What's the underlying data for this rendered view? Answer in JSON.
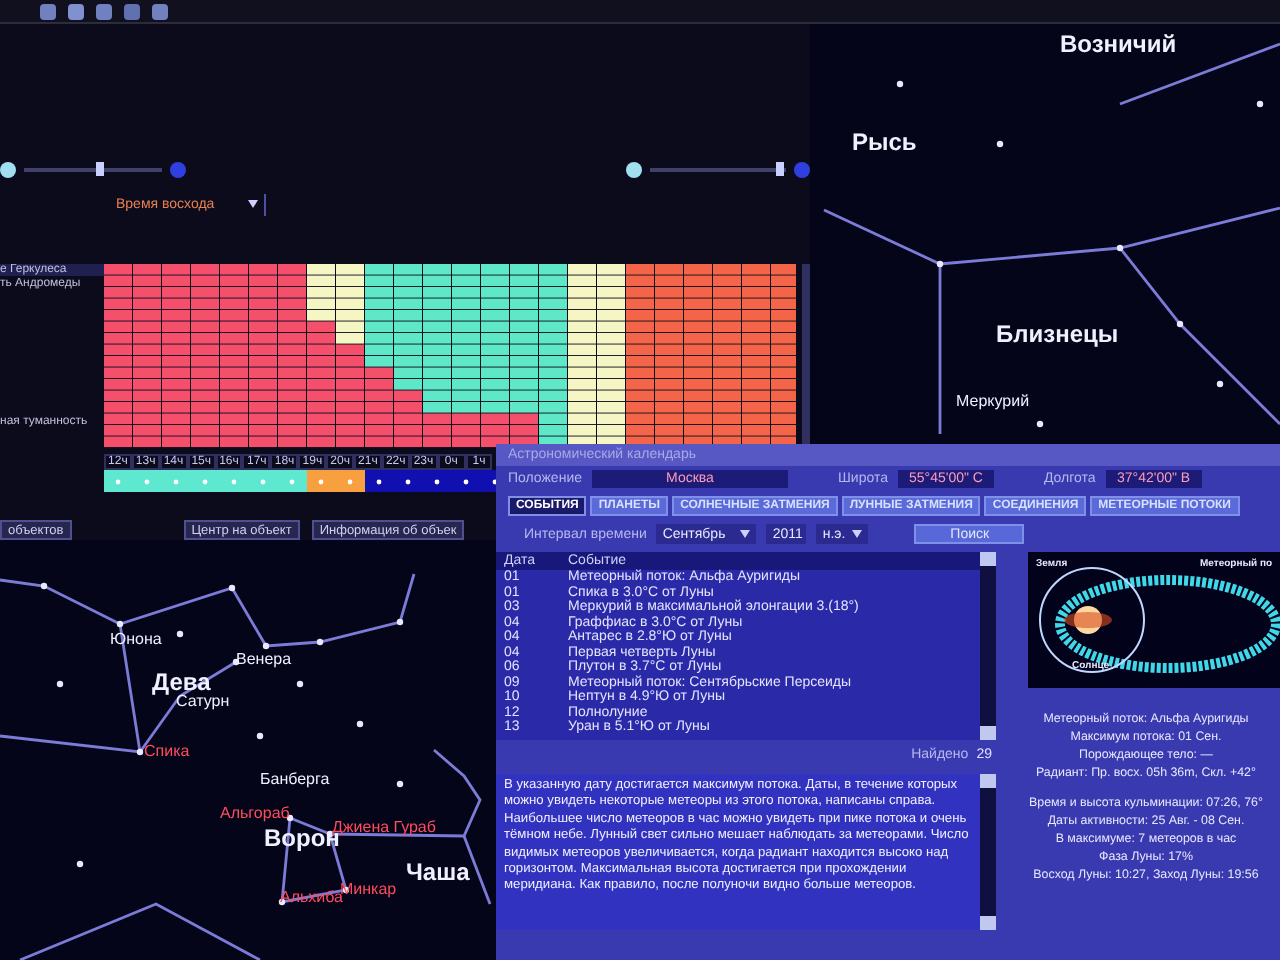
{
  "planner": {
    "sliders": [
      {
        "level": 0.55
      },
      {
        "level": 0.95
      }
    ],
    "sort_dropdown": {
      "value": "Время восхода"
    },
    "objects": [
      {
        "text": "е Геркулеса",
        "selected": true
      },
      {
        "text": "ть Андромеды",
        "selected": false
      },
      {
        "text": "ная туманность",
        "selected": false
      }
    ],
    "hours": [
      "12ч",
      "13ч",
      "14ч",
      "15ч",
      "16ч",
      "17ч",
      "18ч",
      "19ч",
      "20ч",
      "21ч",
      "22ч",
      "23ч",
      "0ч",
      "1ч"
    ],
    "buttons": [
      "объектов",
      "Центр на объект",
      "Информация об объек"
    ]
  },
  "sky": {
    "labels": [
      {
        "text": "Возничий",
        "kind": "constellation"
      },
      {
        "text": "Рысь",
        "kind": "constellation"
      },
      {
        "text": "Близнецы",
        "kind": "constellation"
      },
      {
        "text": "Меркурий",
        "kind": "planet"
      },
      {
        "text": "Юнона",
        "kind": "planet"
      },
      {
        "text": "Венера",
        "kind": "planet"
      },
      {
        "text": "Дева",
        "kind": "constellation"
      },
      {
        "text": "Сатурн",
        "kind": "planet"
      },
      {
        "text": "Спика",
        "kind": "star"
      },
      {
        "text": "Банберга",
        "kind": "planet"
      },
      {
        "text": "Альгораб",
        "kind": "star"
      },
      {
        "text": "Ворон",
        "kind": "constellation"
      },
      {
        "text": "Джиена Гураб",
        "kind": "star"
      },
      {
        "text": "Чаша",
        "kind": "constellation"
      },
      {
        "text": "Минкар",
        "kind": "star"
      },
      {
        "text": "Альхиба",
        "kind": "star"
      }
    ]
  },
  "calendar": {
    "title": "Астрономический календарь",
    "location_label": "Положение",
    "location": "Москва",
    "latitude_label": "Широта",
    "latitude": "55°45'00\" С",
    "longitude_label": "Долгота",
    "longitude": "37°42'00\" В",
    "tabs": [
      {
        "label": "СОБЫТИЯ",
        "selected": true
      },
      {
        "label": "ПЛАНЕТЫ",
        "selected": false
      },
      {
        "label": "СОЛНЕЧНЫЕ ЗАТМЕНИЯ",
        "selected": false
      },
      {
        "label": "ЛУННЫЕ ЗАТМЕНИЯ",
        "selected": false
      },
      {
        "label": "СОЕДИНЕНИЯ",
        "selected": false
      },
      {
        "label": "МЕТЕОРНЫЕ ПОТОКИ",
        "selected": false
      }
    ],
    "interval_label": "Интервал времени",
    "month": "Сентябрь",
    "year": "2011",
    "era": "н.э.",
    "search_button": "Поиск",
    "columns": [
      "Дата",
      "Событие"
    ],
    "events": [
      {
        "date": "01",
        "text": "Метеорный поток: Альфа Ауригиды"
      },
      {
        "date": "01",
        "text": "Спика в 3.0°С от Луны"
      },
      {
        "date": "03",
        "text": "Меркурий в максимальной элонгации 3.(18°)"
      },
      {
        "date": "04",
        "text": "Граффиас в 3.0°С от Луны"
      },
      {
        "date": "04",
        "text": "Антарес в 2.8°Ю от Луны"
      },
      {
        "date": "04",
        "text": "Первая четверть Луны"
      },
      {
        "date": "06",
        "text": "Плутон в 3.7°С от Луны"
      },
      {
        "date": "09",
        "text": "Метеорный поток: Сентябрьские Персеиды"
      },
      {
        "date": "10",
        "text": "Нептун в 4.9°Ю от Луны"
      },
      {
        "date": "12",
        "text": "Полнолуние"
      },
      {
        "date": "13",
        "text": "Уран в 5.1°Ю от Луны"
      }
    ],
    "found_label": "Найдено",
    "found_count": "29",
    "description": "В указанную дату достигается максимум потока. Даты, в течение которых можно увидеть некоторые метеоры из этого потока, написаны справа. Наибольшее число метеоров в час можно увидеть при пике потока и очень тёмном небе. Лунный свет сильно мешает наблюдать за метеорами. Число видимых метеоров увеличивается, когда радиант находится высоко над горизонтом. Максимальная высота достигается при прохождении меридиана. Как правило, после полуночи видно больше метеоров.",
    "diagram_labels": [
      "Земля",
      "Метеорный по",
      "Солнце"
    ],
    "info": [
      [
        "Метеорный поток: Альфа Ауригиды",
        "Максимум потока: 01 Сен.",
        "Порождающее тело: —",
        "Радиант: Пр. восх. 05h 36m, Скл. +42°"
      ],
      [
        "Время и высота кульминации: 07:26, 76°",
        "Даты активности: 25 Авг. - 08 Сен.",
        "В максимуме: 7 метеоров в час",
        "Фаза Луны: 17%",
        "Восход Луны: 10:27, Заход Луны: 19:56"
      ]
    ]
  }
}
